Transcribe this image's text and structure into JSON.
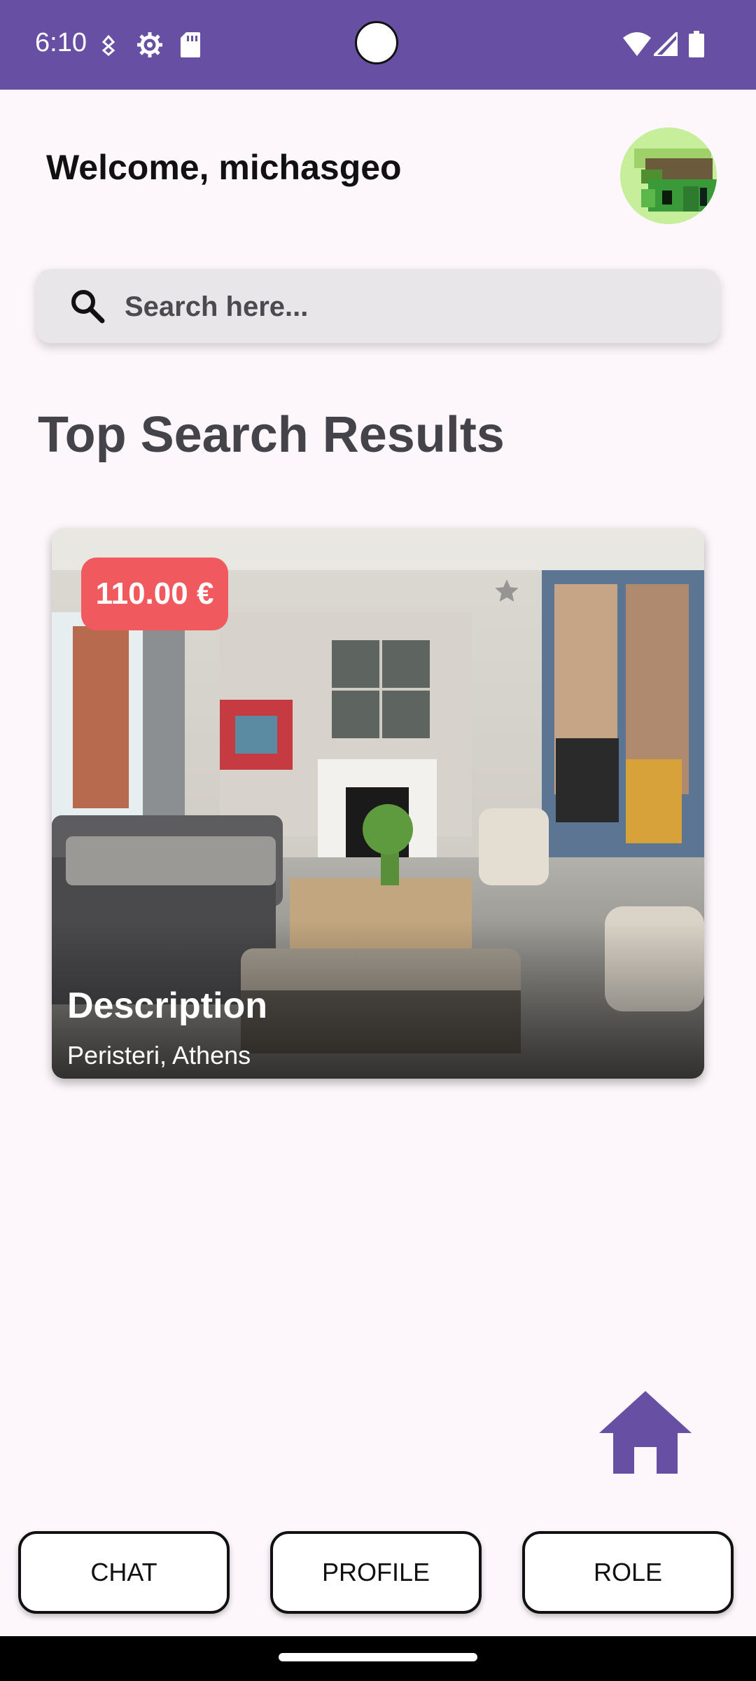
{
  "status_bar": {
    "time": "6:10",
    "icons": [
      "nfc-icon",
      "settings-icon",
      "sd-card-icon",
      "wifi-icon",
      "signal-icon",
      "battery-icon"
    ],
    "background": "#6750a4"
  },
  "header": {
    "welcome": "Welcome, michasgeo",
    "avatar_icon": "avatar-icon"
  },
  "search": {
    "placeholder": "Search here...",
    "icon": "search-icon"
  },
  "section_title": "Top Search Results",
  "results": [
    {
      "price": "110.00 €",
      "title": "Description",
      "location": "Peristeri, Athens",
      "image": "living-room-photo",
      "favorite_icon": "star-icon"
    }
  ],
  "home_button": {
    "icon": "home-icon",
    "color": "#6750a4"
  },
  "bottom_nav": {
    "chat": "CHAT",
    "profile": "PROFILE",
    "role": "ROLE"
  },
  "colors": {
    "accent": "#6750a4",
    "price_badge": "#f05a5e",
    "background": "#fdf7fc"
  }
}
